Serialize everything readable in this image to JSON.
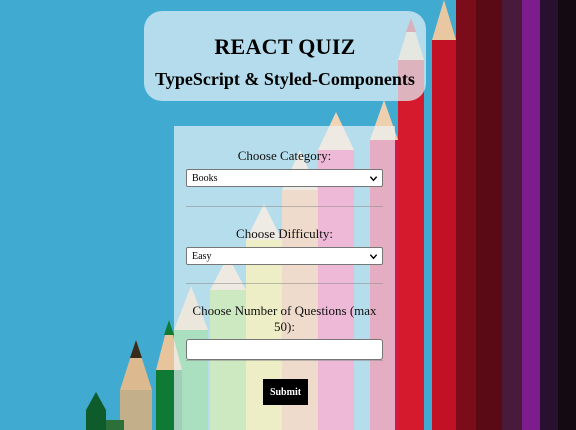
{
  "header": {
    "title": "REACT QUIZ",
    "subtitle": "TypeScript & Styled-Components"
  },
  "form": {
    "category_label": "Choose Category:",
    "category_value": "Books",
    "difficulty_label": "Choose Difficulty:",
    "difficulty_value": "Easy",
    "questions_label": "Choose Number of Questions (max 50):",
    "questions_value": "",
    "submit_label": "Submit"
  },
  "colors": {
    "background": "#3fa9cf",
    "submit_bg": "#000000"
  }
}
